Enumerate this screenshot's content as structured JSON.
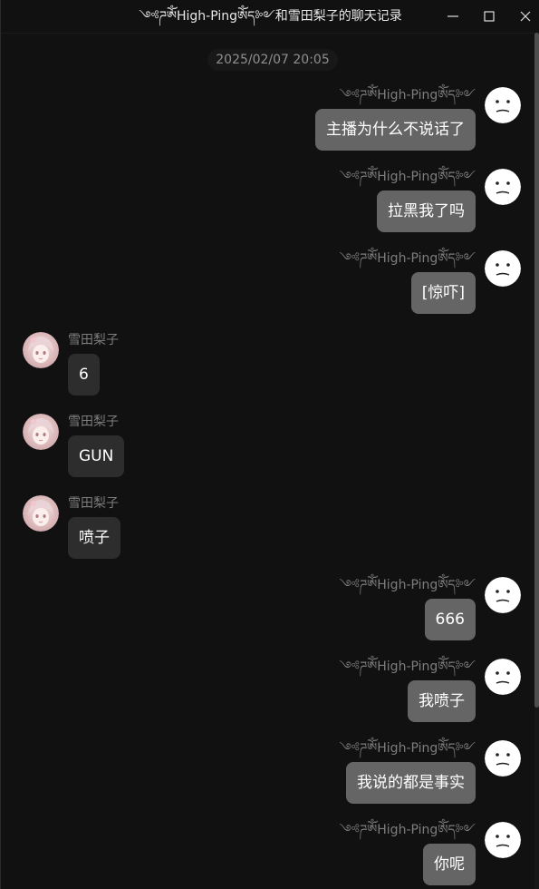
{
  "window": {
    "title": "༺ཌༀHigh-Pingༀད༻和雪田梨子的聊天记录",
    "controls": [
      "minimize-icon",
      "maximize-icon",
      "close-icon"
    ]
  },
  "chat": {
    "timestamp": "2025/02/07 20:05",
    "messages": [
      {
        "side": "right",
        "sender": "༺ཌༀHigh-Pingༀད༻",
        "text": "主播为什么不说话了",
        "avatar": "confused-face-icon"
      },
      {
        "side": "right",
        "sender": "༺ཌༀHigh-Pingༀད༻",
        "text": "拉黑我了吗",
        "avatar": "confused-face-icon"
      },
      {
        "side": "right",
        "sender": "༺ཌༀHigh-Pingༀད༻",
        "text": "[惊吓]",
        "avatar": "confused-face-icon"
      },
      {
        "side": "left",
        "sender": "雪田梨子",
        "text": "6",
        "avatar": "anime-girl-avatar"
      },
      {
        "side": "left",
        "sender": "雪田梨子",
        "text": "GUN",
        "avatar": "anime-girl-avatar"
      },
      {
        "side": "left",
        "sender": "雪田梨子",
        "text": "喷子",
        "avatar": "anime-girl-avatar"
      },
      {
        "side": "right",
        "sender": "༺ཌༀHigh-Pingༀད༻",
        "text": "666",
        "avatar": "confused-face-icon"
      },
      {
        "side": "right",
        "sender": "༺ཌༀHigh-Pingༀད༻",
        "text": "我喷子",
        "avatar": "confused-face-icon"
      },
      {
        "side": "right",
        "sender": "༺ཌༀHigh-Pingༀད༻",
        "text": "我说的都是事实",
        "avatar": "confused-face-icon"
      },
      {
        "side": "right",
        "sender": "༺ཌༀHigh-Pingༀད༻",
        "text": "你呢",
        "avatar": "confused-face-icon"
      }
    ]
  },
  "colors": {
    "background": "#111111",
    "self_bubble": "#656565",
    "other_bubble": "#2d2d2d",
    "sender_name": "#7d7d7d",
    "message_text": "#ffffff"
  }
}
